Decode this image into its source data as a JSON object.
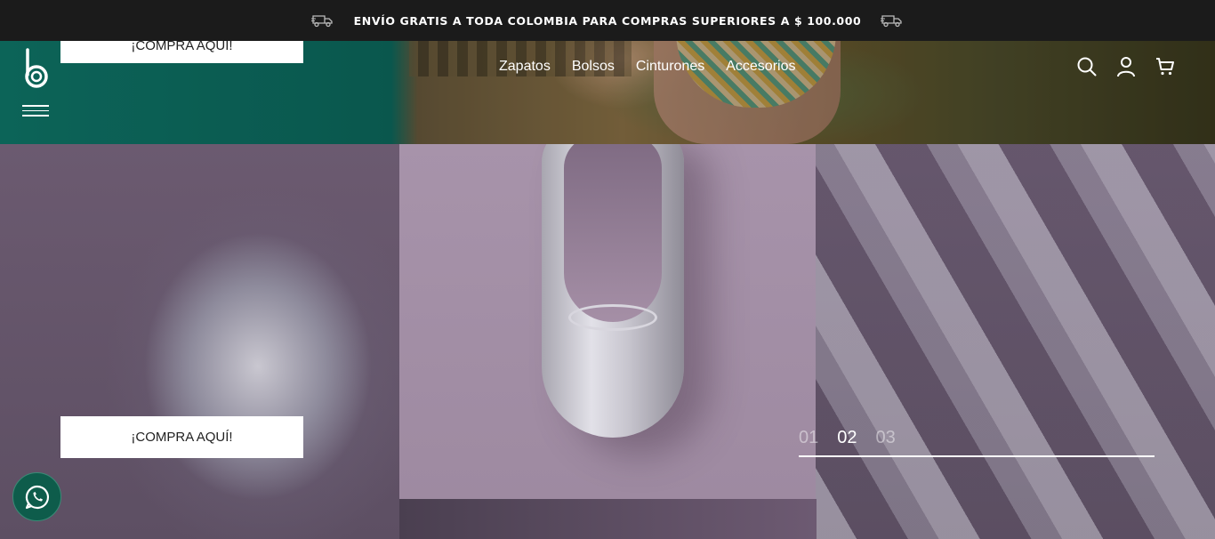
{
  "announcement": {
    "text": "ENVÍO GRATIS A TODA COLOMBIA PARA COMPRAS SUPERIORES A $ 100.000",
    "icon_left": "truck-icon",
    "icon_right": "truck-icon"
  },
  "header": {
    "logo": "b",
    "menu_icon": "hamburger-icon",
    "nav": [
      "Zapatos",
      "Bolsos",
      "Cinturones",
      "Accesorios"
    ],
    "icons": [
      "search-icon",
      "user-icon",
      "cart-icon"
    ]
  },
  "hero": {
    "prev_cta_label": "¡COMPRA AQUÍ!",
    "cta_label": "¡COMPRA AQUÍ!",
    "slides": [
      "01",
      "02",
      "03"
    ],
    "active_slide": "02"
  },
  "floating": {
    "whatsapp_icon": "whatsapp-icon"
  },
  "colors": {
    "topbar": "#1b1b1b",
    "whatsapp": "#0e5c4b",
    "cta_bg": "#ffffff"
  }
}
